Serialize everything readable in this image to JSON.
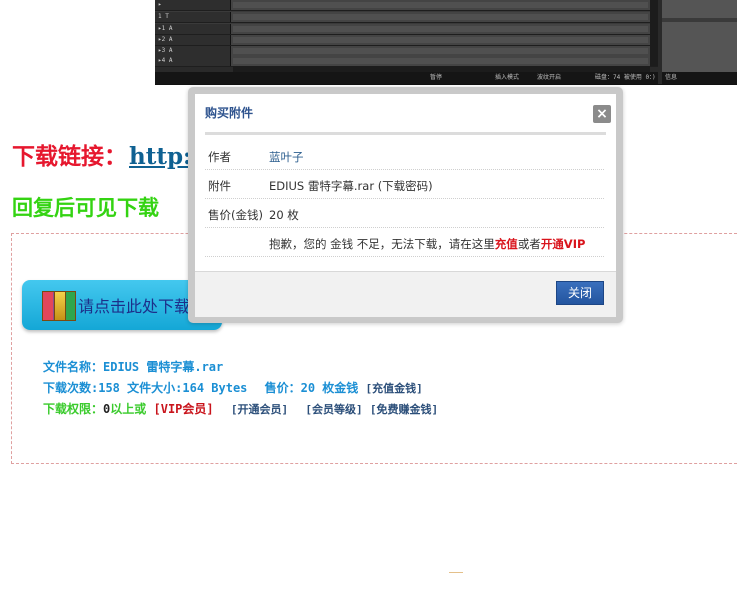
{
  "editor": {
    "tracks": [
      {
        "label": "▸"
      },
      {
        "label": "1 T"
      },
      {
        "label": "▸1 A"
      },
      {
        "label": "▸2 A"
      },
      {
        "label": "▸3 A"
      },
      {
        "label": "▸4 A"
      }
    ],
    "status": {
      "pause": "暂停",
      "insert_mode": "插入模式",
      "ripple": "波纹开启",
      "disk": "磁盘：74 被使用 0：)"
    },
    "right_status": "信息"
  },
  "page": {
    "download_label": "下载链接：",
    "download_url": "http:",
    "reply_note": "回复后可见下载",
    "download_button_label": "请点击此处下载",
    "file_info": {
      "name_line": "文件名称：EDIUS 雷特字幕.rar",
      "count_label": "下载次数:158",
      "size_label": "文件大小:164 Bytes",
      "price_label": "售价：20 枚金钱",
      "recharge_link": "[充值金钱]",
      "limit_label": "下载权限：",
      "limit_value": "0",
      "limit_suffix": "以上或",
      "vip_member": "[VIP会员]",
      "open_member": "[开通会员]",
      "member_level": "[会员等级]",
      "free_coins": "[免费赚金钱]"
    }
  },
  "modal": {
    "title": "购买附件",
    "close_x": "×",
    "rows": [
      {
        "key": "作者",
        "value": "蓝叶子"
      },
      {
        "key": "附件",
        "value": "EDIUS 雷特字幕.rar (下载密码)"
      },
      {
        "key": "售价(金钱)",
        "value": "20 枚"
      }
    ],
    "message_prefix": "抱歉，您的 金钱 不足，无法下载，请在这里",
    "recharge": "充值",
    "or": "或者",
    "open_vip": "开通VIP",
    "close_button": "关闭"
  }
}
